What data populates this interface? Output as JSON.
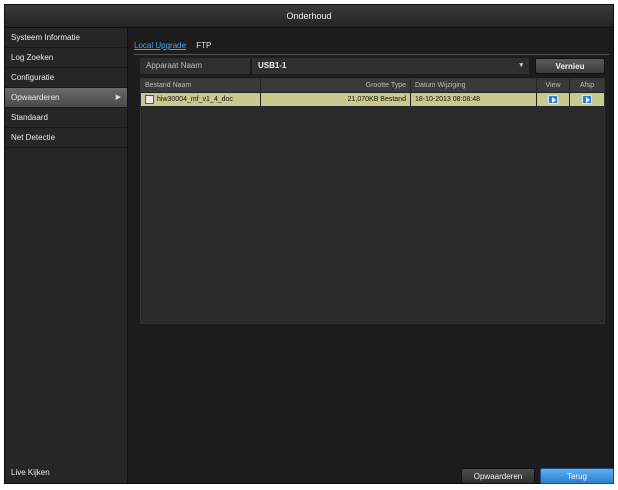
{
  "window": {
    "title": "Onderhoud"
  },
  "sidebar": {
    "items": [
      {
        "label": "Systeem Informatie"
      },
      {
        "label": "Log Zoeken"
      },
      {
        "label": "Configuratie"
      },
      {
        "label": "Opwaarderen",
        "active": true,
        "arrow": "▶"
      },
      {
        "label": "Standaard"
      },
      {
        "label": "Net Detectie"
      }
    ],
    "bottom_label": "Live Kijken"
  },
  "tabs": [
    {
      "label": "Local Upgrade",
      "active": true
    },
    {
      "label": "FTP",
      "active": false
    }
  ],
  "device": {
    "label": "Apparaat Naam",
    "value": "USB1-1",
    "dropdown_icon": "chevron-down-icon",
    "refresh_label": "Vernieu"
  },
  "table": {
    "columns": [
      "Bestand Naam",
      "Grootte Type",
      "Datum Wijziging",
      "View",
      "Afsp"
    ],
    "rows": [
      {
        "name": "hiw30004_mf_v1_4_doc",
        "size_type": "21,070KB Bestand",
        "date": "18-10-2013 08:08:48",
        "view_icon": "play-icon",
        "play_icon": "play-icon"
      }
    ]
  },
  "buttons": {
    "upgrade": "Opwaarderen",
    "back": "Terug"
  },
  "colors": {
    "accent_blue": "#2b7fd0",
    "selected_row": "#c9c88f",
    "tab_active": "#4aa3e8"
  }
}
